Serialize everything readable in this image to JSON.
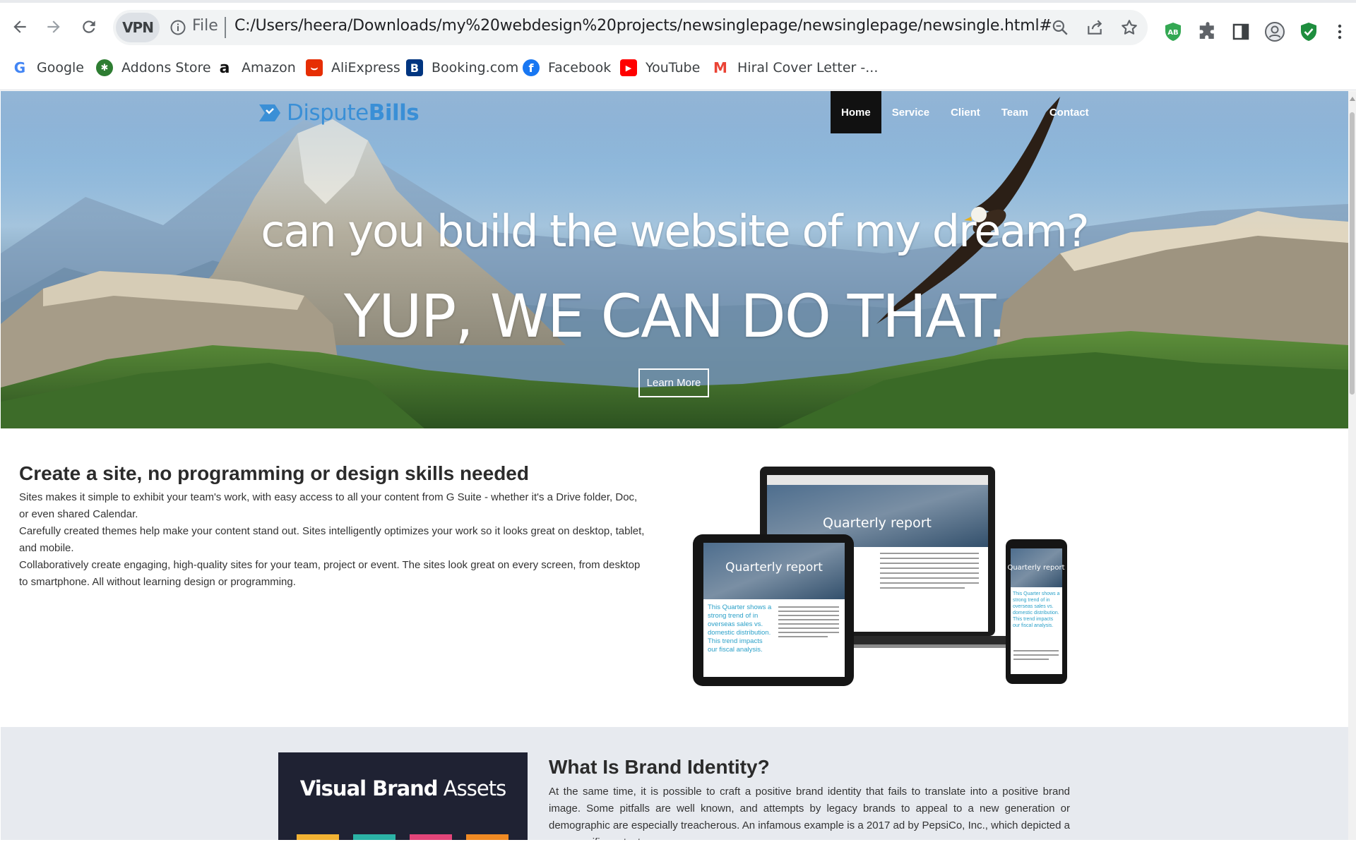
{
  "browser": {
    "vpn_label": "VPN",
    "scheme": "File",
    "url": "C:/Users/heera/Downloads/my%20webdesign%20projects/newsinglepage/newsinglepage/newsingle.html#",
    "extension_badge": "AB",
    "bookmarks": [
      {
        "label": "Google",
        "icon": "google-icon"
      },
      {
        "label": "Addons Store",
        "icon": "addons-store-icon"
      },
      {
        "label": "Amazon",
        "icon": "amazon-icon"
      },
      {
        "label": "AliExpress",
        "icon": "aliexpress-icon"
      },
      {
        "label": "Booking.com",
        "icon": "booking-icon"
      },
      {
        "label": "Facebook",
        "icon": "facebook-icon"
      },
      {
        "label": "YouTube",
        "icon": "youtube-icon"
      },
      {
        "label": "Hiral Cover Letter -...",
        "icon": "gmail-icon"
      }
    ]
  },
  "site": {
    "brand_part1": "Dispute",
    "brand_part2": "Bills",
    "nav": [
      {
        "label": "Home",
        "active": true
      },
      {
        "label": "Service",
        "active": false
      },
      {
        "label": "Client",
        "active": false
      },
      {
        "label": "Team",
        "active": false
      },
      {
        "label": "Contact",
        "active": false
      }
    ],
    "hero": {
      "question": "can you build the website of my dream?",
      "answer": "YUP, WE CAN DO THAT.",
      "button": "Learn More"
    }
  },
  "section1": {
    "title": "Create a site, no programming or design skills needed",
    "paragraphs": [
      "Sites makes it simple to exhibit your team's work, with easy access to all your content from G Suite - whether it's a Drive folder, Doc, or even shared Calendar.",
      "Carefully created themes help make your content stand out. Sites intelligently optimizes your work so it looks great on desktop, tablet, and mobile.",
      "Collaboratively create engaging, high-quality sites for your team, project or event. The sites look great on every screen, from desktop to smartphone. All without learning design or programming."
    ],
    "devices": {
      "laptop_title": "Quarterly report",
      "tablet_title": "Quarterly report",
      "phone_title": "Quarterly report",
      "tablet_blurb": "This Quarter shows a strong trend of in overseas sales vs. domestic distribution. This trend impacts our fiscal analysis.",
      "phone_blurb": "This Quarter shows a strong trend of in overseas sales vs. domestic distribution. This trend impacts our fiscal analysis."
    }
  },
  "section2": {
    "card_title_bold": "Visual Brand",
    "card_title_rest": "Assets",
    "title": "What Is Brand Identity?",
    "body": "At the same time, it is possible to craft a positive brand identity that fails to translate into a positive brand image. Some pitfalls are well known, and attempts by legacy brands to appeal to a new generation or demographic are especially treacherous. An infamous example is a 2017 ad by PepsiCo, Inc., which depicted a non-specific protest"
  },
  "colors": {
    "brand_blue": "#3a8fd6",
    "nav_active_bg": "#111111",
    "card_bg": "#1f2233",
    "section2_bg": "#e7eaef",
    "bar_colors": [
      "#f2b233",
      "#2bb3a6",
      "#e2457a",
      "#f08a24"
    ]
  }
}
